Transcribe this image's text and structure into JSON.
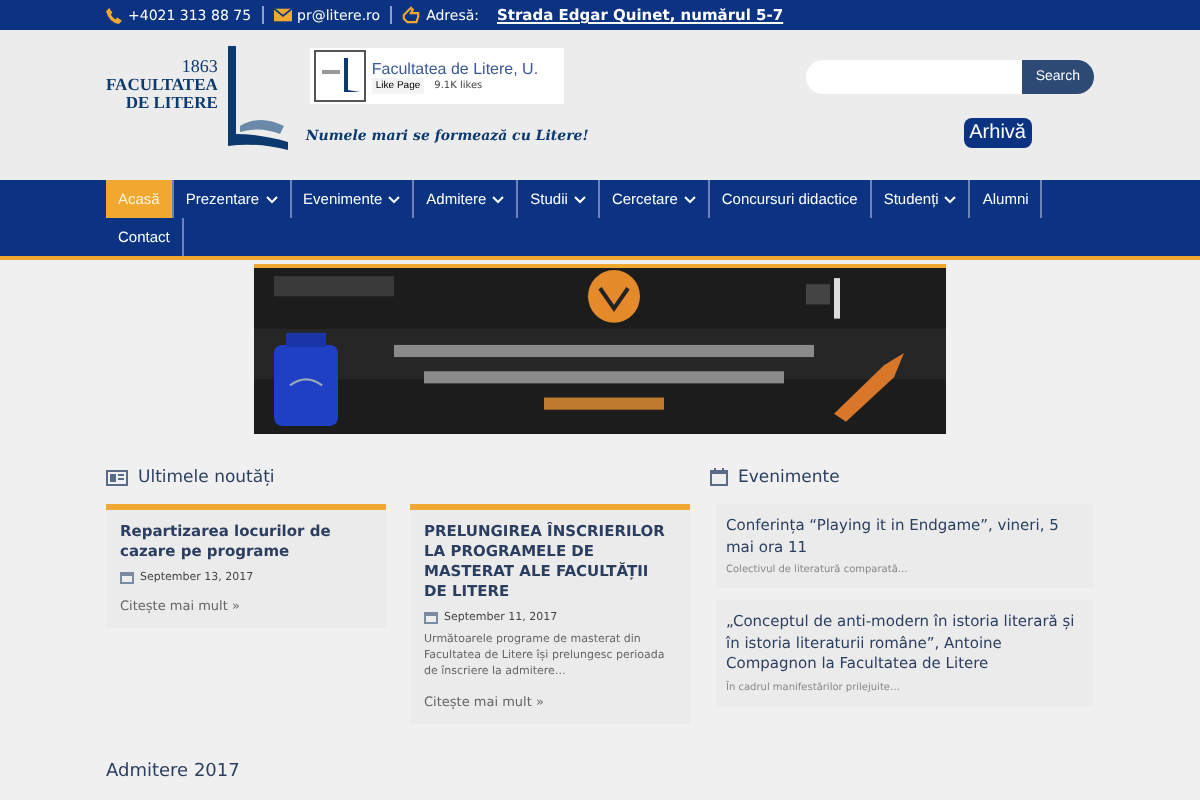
{
  "topbar": {
    "phone": "+4021 313 88 75",
    "email": "pr@litere.ro",
    "address_label": "Adresă:",
    "address": "Strada Edgar Quinet, numărul 5-7"
  },
  "header": {
    "logo_year": "1863",
    "logo_line1": "FACULTATEA",
    "logo_line2": "DE LITERE",
    "fb_name": "Facultatea de Litere, U.",
    "fb_like": "Like Page",
    "fb_likes": "9.1K likes",
    "motto": "Numele mari se formează cu Litere!",
    "search_button": "Search",
    "archive_button": "Arhivă"
  },
  "nav": [
    {
      "label": "Acasă",
      "selected": true,
      "dropdown": false
    },
    {
      "label": "Prezentare",
      "selected": false,
      "dropdown": true
    },
    {
      "label": "Evenimente",
      "selected": false,
      "dropdown": true
    },
    {
      "label": "Admitere",
      "selected": false,
      "dropdown": true
    },
    {
      "label": "Studii",
      "selected": false,
      "dropdown": true
    },
    {
      "label": "Cercetare",
      "selected": false,
      "dropdown": true
    },
    {
      "label": "Concursuri didactice",
      "selected": false,
      "dropdown": false
    },
    {
      "label": "Studenți",
      "selected": false,
      "dropdown": true
    },
    {
      "label": "Alumni",
      "selected": false,
      "dropdown": false
    },
    {
      "label": "Contact",
      "selected": false,
      "dropdown": false
    }
  ],
  "news": {
    "title": "Ultimele noutăți",
    "items": [
      {
        "title": "Repartizarea locurilor de cazare pe programe",
        "date": "September 13, 2017",
        "more": "Citește mai mult »"
      },
      {
        "title": "PRELUNGIREA ÎNSCRIERILOR LA PROGRAMELE DE MASTERAT ALE FACULTĂȚII DE LITERE",
        "date": "September 11, 2017",
        "excerpt": "Următoarele programe de masterat din Facultatea de Litere își prelungesc perioada de înscriere la admitere…",
        "more": "Citește mai mult »"
      }
    ]
  },
  "events": {
    "title": "Evenimente",
    "items": [
      {
        "title": "Conferința “Playing it in Endgame”, vineri, 5 mai ora 11",
        "excerpt": "Colectivul de literatură comparată…"
      },
      {
        "title": "„Conceptul de anti-modern în istoria literară și în istoria literaturii române”, Antoine Compagnon la Facultatea de Litere",
        "excerpt": "În cadrul manifestărilor prilejuite…"
      }
    ]
  },
  "section_heading": "Admitere 2017"
}
